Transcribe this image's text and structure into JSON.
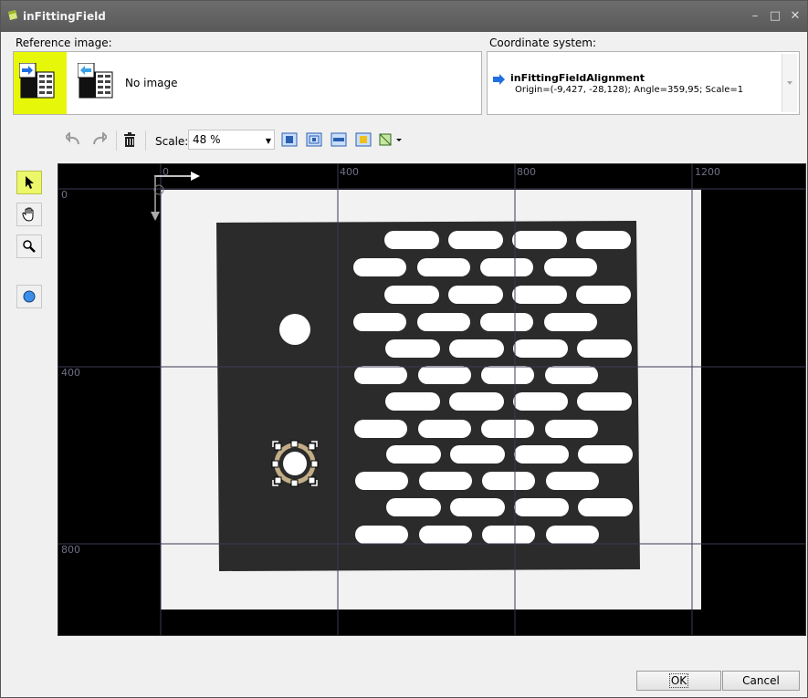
{
  "window": {
    "title": "inFittingField"
  },
  "reference": {
    "label": "Reference image:",
    "no_image": "No image"
  },
  "coordinate": {
    "label": "Coordinate system:",
    "name": "inFittingFieldAlignment",
    "value": "Origin=(-9,427, -28,128); Angle=359,95; Scale=1"
  },
  "toolbar": {
    "scale_label": "Scale:",
    "scale_value": "48 %"
  },
  "ruler": {
    "x_ticks": [
      "0",
      "400",
      "800",
      "1200"
    ],
    "y_ticks": [
      "0",
      "400",
      "800"
    ]
  },
  "buttons": {
    "ok": "OK",
    "cancel": "Cancel"
  },
  "colors": {
    "accent_selected": "#e6f70a",
    "titlebar": "#5f5f5f",
    "arrow_blue": "#1f6fe0"
  }
}
